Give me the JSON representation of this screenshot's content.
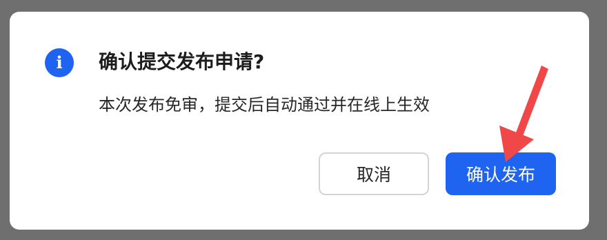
{
  "dialog": {
    "icon": "info-icon",
    "icon_glyph": "i",
    "title": "确认提交发布申请?",
    "message": "本次发布免审，提交后自动通过并在线上生效",
    "cancel_label": "取消",
    "confirm_label": "确认发布"
  },
  "colors": {
    "backdrop": "#6f6f6f",
    "primary": "#1f63f1",
    "annotation_arrow": "#f04848"
  },
  "annotation": {
    "icon": "red-arrow-icon"
  }
}
